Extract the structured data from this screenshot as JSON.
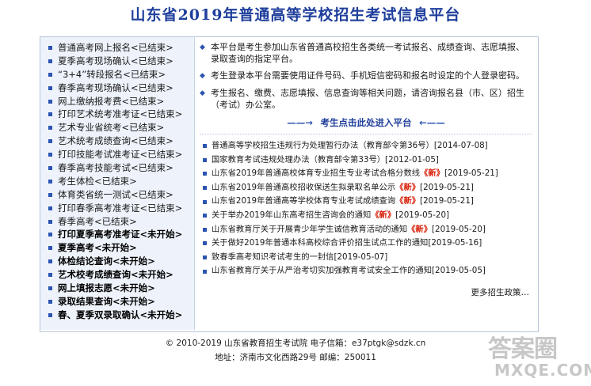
{
  "page": {
    "title": "山东省2019年普通高等学校招生考试信息平台"
  },
  "sidebar": {
    "items": [
      {
        "label": "普通高考网上报名<已结束>",
        "bold": false
      },
      {
        "label": "夏季高考现场确认<已结束>",
        "bold": false
      },
      {
        "label": "“3+4”转段报名<已结束>",
        "bold": false
      },
      {
        "label": "春季高考现场确认<已结束>",
        "bold": false
      },
      {
        "label": "网上缴纳报考费<已结束>",
        "bold": false
      },
      {
        "label": "打印艺术统考准考证<已结束>",
        "bold": false
      },
      {
        "label": "艺术专业省统考<已结束>",
        "bold": false
      },
      {
        "label": "艺术统考成绩查询<已结束>",
        "bold": false
      },
      {
        "label": "打印技能考试准考证<已结束>",
        "bold": false
      },
      {
        "label": "春季高考技能考试<已结束>",
        "bold": false
      },
      {
        "label": "考生体检<已结束>",
        "bold": false
      },
      {
        "label": "体育类省统一测试<已结束>",
        "bold": false
      },
      {
        "label": "打印春季高考准考证<已结束>",
        "bold": false
      },
      {
        "label": "春季高考<已结束>",
        "bold": false
      },
      {
        "label": "打印夏季高考准考证<未开始>",
        "bold": true
      },
      {
        "label": "夏季高考<未开始>",
        "bold": true
      },
      {
        "label": "体检结论查询<未开始>",
        "bold": true
      },
      {
        "label": "艺术校考成绩查询<未开始>",
        "bold": true
      },
      {
        "label": "网上填报志愿<未开始>",
        "bold": true
      },
      {
        "label": "录取结果查询<未开始>",
        "bold": true
      },
      {
        "label": "春、夏季双录取确认<未开始>",
        "bold": true
      }
    ]
  },
  "notices": [
    "本平台是考生参加山东省普通高校招生各类统一考试报名、成绩查询、志愿填报、录取查询的指定平台。",
    "考生登录本平台需要使用证件号码、手机短信密码和报名时设定的个人登录密码。",
    "考生报名、缴费、志愿填报、信息查询等相关问题，请咨询报名县（市、区）招生（考试）办公室。"
  ],
  "enter": {
    "left_arrow": "——→",
    "label": "考生点击此处进入平台",
    "right_arrow": "←——"
  },
  "news": [
    {
      "title": "普通高等学校招生违规行为处理暂行办法（教育部令第36号）",
      "new": "",
      "date": "[2014-07-08]"
    },
    {
      "title": "国家教育考试违规处理办法（教育部令第33号）",
      "new": "",
      "date": "[2012-01-05]"
    },
    {
      "title": "山东省2019年普通高校体育专业招生专业考试合格分数线",
      "new": "《新》",
      "date": "[2019-05-21]"
    },
    {
      "title": "山东省2019年普通高校招收保送生拟录取名单公示",
      "new": "《新》",
      "date": "[2019-05-21]"
    },
    {
      "title": "山东省2019年普通高等学校体育专业考试成绩查询",
      "new": "《新》",
      "date": "[2019-05-21]"
    },
    {
      "title": "关于举办2019年山东高考招生咨询会的通知",
      "new": "《新》",
      "date": "[2019-05-20]"
    },
    {
      "title": "山东省教育厅关于开展青少年学生诚信教育活动的通知",
      "new": "《新》",
      "date": "[2019-05-20]"
    },
    {
      "title": "关于做好2019年普通本科高校综合评价招生试点工作的通知",
      "new": "",
      "date": "[2019-05-16]"
    },
    {
      "title": "致春季高考知识考试考生的一封信",
      "new": "",
      "date": "[2019-05-07]"
    },
    {
      "title": "山东省教育厅关于从严治考切实加强教育考试安全工作的通知",
      "new": "",
      "date": "[2019-05-05]"
    }
  ],
  "more_label": "更多招生政策…",
  "footer": {
    "line1": "©  2010-2019  山东省教育招生考试院  电子信箱：e37ptgk@sdzk.cn",
    "line2": "地址：济南市文化西路29号  邮编：250011"
  },
  "watermark": {
    "big": "答案圈",
    "small": "MXQE.COM"
  },
  "colors": {
    "title": "#1f3f9c",
    "accent": "#2b55b0",
    "new_badge": "#d81e06",
    "sidebar_bg": "#eef3fb"
  }
}
